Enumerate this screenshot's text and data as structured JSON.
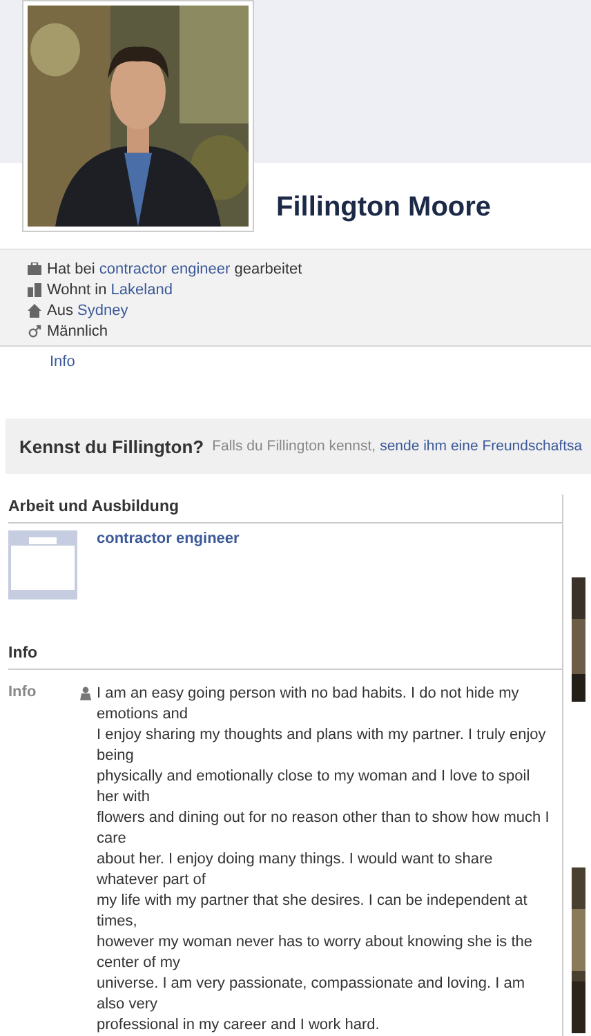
{
  "profile": {
    "name": "Fillington Moore"
  },
  "facts": [
    {
      "kind": "work",
      "text": "Hat bei",
      "link": "contractor engineer",
      "after": "gearbeitet"
    },
    {
      "kind": "lives",
      "text": "Wohnt in",
      "link": "Lakeland"
    },
    {
      "kind": "from",
      "text": "Aus",
      "link": "Sydney"
    },
    {
      "kind": "gender",
      "text": "Männlich"
    }
  ],
  "info_link": "Info",
  "know_bar": {
    "title": "Kennst du Fillington?",
    "text": "Falls du Fillington kennst,",
    "link": "sende ihm eine Freundschaftsa"
  },
  "work_section": {
    "title": "Arbeit und Ausbildung",
    "employer": "contractor engineer"
  },
  "info_section": {
    "title": "Info",
    "label": "Info",
    "bio": [
      "I am an easy going person with no bad habits. I do not hide my emotions and",
      "I enjoy sharing my thoughts and plans with my partner. I truly enjoy being",
      "physically and emotionally close to my woman and I love to spoil her with",
      "flowers and dining out for no reason other than to show how much I care",
      "about her. I enjoy doing many things. I would want to share whatever part of",
      "my life with my partner that she desires. I can be independent at times,",
      "however my woman never has to worry about knowing she is the center of my",
      "universe. I am very passionate, compassionate and loving. I am also very",
      "professional in my career and I work hard."
    ]
  }
}
